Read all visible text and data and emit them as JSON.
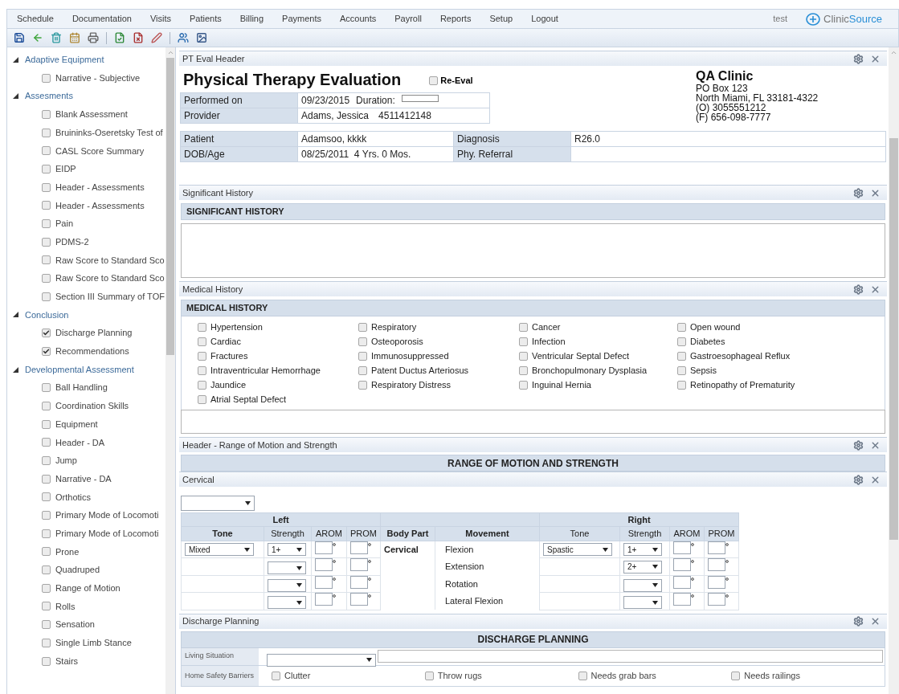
{
  "menu": {
    "items": [
      "Schedule",
      "Documentation",
      "Visits",
      "Patients",
      "Billing",
      "Payments",
      "Accounts",
      "Payroll",
      "Reports",
      "Setup",
      "Logout"
    ],
    "user": "test",
    "logo": {
      "first": "Clinic",
      "second": "Source"
    }
  },
  "sidebar": {
    "groups": [
      {
        "label": "Adaptive Equipment",
        "expanded": true,
        "children": [
          {
            "label": "Narrative - Subjective",
            "checked": false
          }
        ]
      },
      {
        "label": "Assesments",
        "expanded": true,
        "children": [
          {
            "label": "Blank Assessment",
            "checked": false
          },
          {
            "label": "Bruininks-Oseretsky Test of",
            "checked": false
          },
          {
            "label": "CASL Score Summary",
            "checked": false
          },
          {
            "label": "EIDP",
            "checked": false
          },
          {
            "label": "Header - Assessments",
            "checked": false
          },
          {
            "label": "Header - Assessments",
            "checked": false
          },
          {
            "label": "Pain",
            "checked": false
          },
          {
            "label": "PDMS-2",
            "checked": false
          },
          {
            "label": "Raw Score to Standard Sco",
            "checked": false
          },
          {
            "label": "Raw Score to Standard Sco",
            "checked": false
          },
          {
            "label": "Section III Summary of TOF",
            "checked": false
          }
        ]
      },
      {
        "label": "Conclusion",
        "expanded": true,
        "children": [
          {
            "label": "Discharge Planning",
            "checked": true
          },
          {
            "label": "Recommendations",
            "checked": true
          }
        ]
      },
      {
        "label": "Developmental Assessment",
        "expanded": true,
        "children": [
          {
            "label": "Ball Handling",
            "checked": false
          },
          {
            "label": "Coordination Skills",
            "checked": false
          },
          {
            "label": "Equipment",
            "checked": false
          },
          {
            "label": "Header - DA",
            "checked": false
          },
          {
            "label": "Jump",
            "checked": false
          },
          {
            "label": "Narrative - DA",
            "checked": false
          },
          {
            "label": "Orthotics",
            "checked": false
          },
          {
            "label": "Primary Mode of Locomoti",
            "checked": false
          },
          {
            "label": "Primary Mode of Locomoti",
            "checked": false
          },
          {
            "label": "Prone",
            "checked": false
          },
          {
            "label": "Quadruped",
            "checked": false
          },
          {
            "label": "Range of Motion",
            "checked": false
          },
          {
            "label": "Rolls",
            "checked": false
          },
          {
            "label": "Sensation",
            "checked": false
          },
          {
            "label": "Single Limb Stance",
            "checked": false
          },
          {
            "label": "Stairs",
            "checked": false
          }
        ]
      }
    ]
  },
  "header": {
    "panel_title": "PT Eval Header",
    "title": "Physical Therapy Evaluation",
    "re_eval": {
      "label": "Re-Eval",
      "checked": false
    },
    "performed_on_label": "Performed on",
    "performed_on": "09/23/2015",
    "duration_label": "Duration:",
    "provider_label": "Provider",
    "provider": "Adams, Jessica",
    "provider_id": "4511412148",
    "clinic": {
      "name": "QA Clinic",
      "lines": [
        "PO Box 123",
        "North Miami, FL 33181-4322",
        "(O) 3055551212",
        "(F) 656-098-7777"
      ]
    },
    "patient_label": "Patient",
    "patient": "Adamsoo, kkkk",
    "diagnosis_label": "Diagnosis",
    "diagnosis": "R26.0",
    "dob_label": "DOB/Age",
    "dob": "08/25/2011  4 Yrs. 0 Mos.",
    "referral_label": "Phy. Referral"
  },
  "significant_history": {
    "panel_title": "Significant History",
    "heading": "SIGNIFICANT HISTORY"
  },
  "medical_history": {
    "panel_title": "Medical History",
    "heading": "MEDICAL HISTORY",
    "conditions": [
      {
        "label": "Hypertension",
        "checked": false
      },
      {
        "label": "Respiratory",
        "checked": false
      },
      {
        "label": "Cancer",
        "checked": false
      },
      {
        "label": "Open wound",
        "checked": false
      },
      {
        "label": "Cardiac",
        "checked": false
      },
      {
        "label": "Osteoporosis",
        "checked": false
      },
      {
        "label": "Infection",
        "checked": false
      },
      {
        "label": "Diabetes",
        "checked": false
      },
      {
        "label": "Fractures",
        "checked": false
      },
      {
        "label": "Immunosuppressed",
        "checked": false
      },
      {
        "label": "Ventricular Septal Defect",
        "checked": false
      },
      {
        "label": "Gastroesophageal Reflux",
        "checked": false
      },
      {
        "label": "Intraventricular Hemorrhage",
        "checked": false
      },
      {
        "label": "Patent Ductus Arteriosus",
        "checked": false
      },
      {
        "label": "Bronchopulmonary Dysplasia",
        "checked": false
      },
      {
        "label": "Sepsis",
        "checked": false
      },
      {
        "label": "Jaundice",
        "checked": false
      },
      {
        "label": "Respiratory Distress",
        "checked": false
      },
      {
        "label": "Inguinal Hernia",
        "checked": false
      },
      {
        "label": "Retinopathy of Prematurity",
        "checked": false
      },
      {
        "label": "Atrial Septal Defect",
        "checked": false
      }
    ]
  },
  "range_header": {
    "panel_title": "Header - Range of Motion and Strength",
    "heading": "RANGE OF MOTION AND STRENGTH"
  },
  "cervical": {
    "panel_title": "Cervical",
    "left_heading": "Left",
    "right_heading": "Right",
    "columns": [
      "Tone",
      "Strength",
      "AROM",
      "PROM",
      "Body Part",
      "Movement",
      "Tone",
      "Strength",
      "AROM",
      "PROM"
    ],
    "rows": [
      {
        "left_tone": "Mixed",
        "left_strength": "1+",
        "body_part": "Cervical",
        "movement": "Flexion",
        "right_tone": "Spastic",
        "right_strength": "1+"
      },
      {
        "movement": "Extension",
        "right_strength": "2+"
      },
      {
        "movement": "Rotation"
      },
      {
        "movement": "Lateral Flexion"
      }
    ]
  },
  "discharge": {
    "panel_title": "Discharge Planning",
    "heading": "DISCHARGE PLANNING",
    "living_label": "Living Situation",
    "barriers_label": "Home Safety Barriers",
    "barriers": [
      {
        "label": "Clutter",
        "checked": false
      },
      {
        "label": "Throw rugs",
        "checked": false
      },
      {
        "label": "Needs grab bars",
        "checked": false
      },
      {
        "label": "Needs railings",
        "checked": false
      }
    ]
  }
}
